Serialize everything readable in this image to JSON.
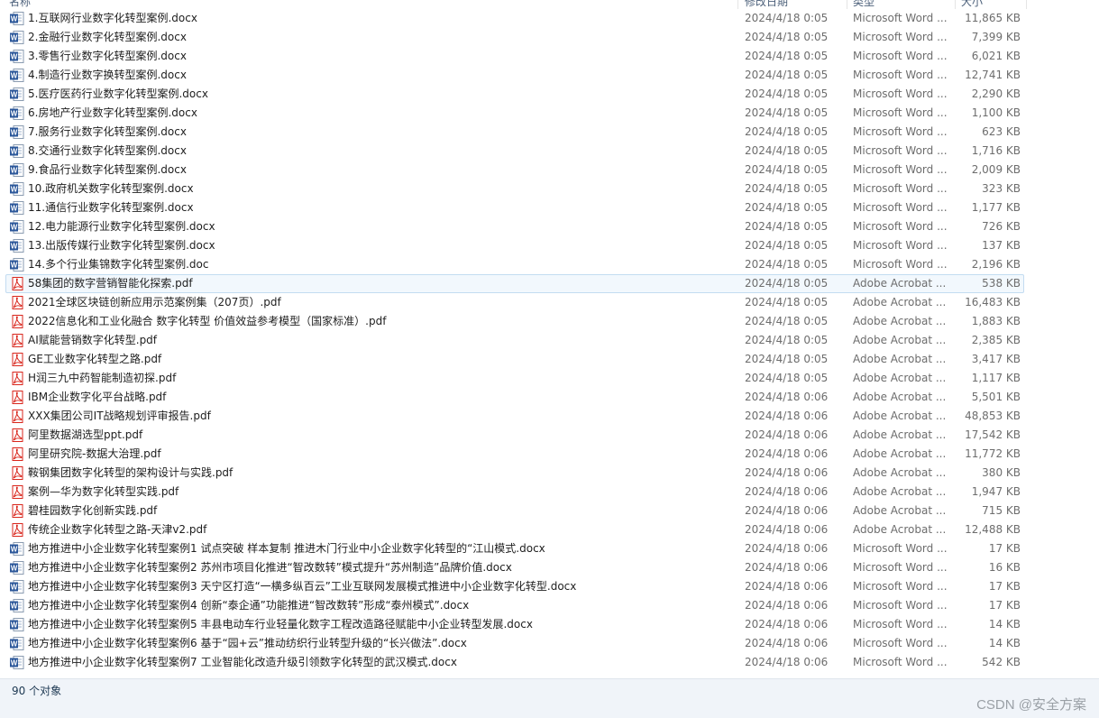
{
  "header": {
    "name": "名称",
    "date": "修改日期",
    "type": "类型",
    "size": "大小"
  },
  "rows": [
    {
      "name": "1.互联网行业数字化转型案例.docx",
      "date": "2024/4/18 0:05",
      "type": "Microsoft Word ...",
      "size": "11,865 KB",
      "icon": "word-icon"
    },
    {
      "name": "2.金融行业数字化转型案例.docx",
      "date": "2024/4/18 0:05",
      "type": "Microsoft Word ...",
      "size": "7,399 KB",
      "icon": "word-icon"
    },
    {
      "name": "3.零售行业数字化转型案例.docx",
      "date": "2024/4/18 0:05",
      "type": "Microsoft Word ...",
      "size": "6,021 KB",
      "icon": "word-icon"
    },
    {
      "name": "4.制造行业数字换转型案例.docx",
      "date": "2024/4/18 0:05",
      "type": "Microsoft Word ...",
      "size": "12,741 KB",
      "icon": "word-icon"
    },
    {
      "name": "5.医疗医药行业数字化转型案例.docx",
      "date": "2024/4/18 0:05",
      "type": "Microsoft Word ...",
      "size": "2,290 KB",
      "icon": "word-icon"
    },
    {
      "name": "6.房地产行业数字化转型案例.docx",
      "date": "2024/4/18 0:05",
      "type": "Microsoft Word ...",
      "size": "1,100 KB",
      "icon": "word-icon"
    },
    {
      "name": "7.服务行业数字化转型案例.docx",
      "date": "2024/4/18 0:05",
      "type": "Microsoft Word ...",
      "size": "623 KB",
      "icon": "word-icon"
    },
    {
      "name": "8.交通行业数字化转型案例.docx",
      "date": "2024/4/18 0:05",
      "type": "Microsoft Word ...",
      "size": "1,716 KB",
      "icon": "word-icon"
    },
    {
      "name": "9.食品行业数字化转型案例.docx",
      "date": "2024/4/18 0:05",
      "type": "Microsoft Word ...",
      "size": "2,009 KB",
      "icon": "word-icon"
    },
    {
      "name": "10.政府机关数字化转型案例.docx",
      "date": "2024/4/18 0:05",
      "type": "Microsoft Word ...",
      "size": "323 KB",
      "icon": "word-icon"
    },
    {
      "name": "11.通信行业数字化转型案例.docx",
      "date": "2024/4/18 0:05",
      "type": "Microsoft Word ...",
      "size": "1,177 KB",
      "icon": "word-icon"
    },
    {
      "name": "12.电力能源行业数字化转型案例.docx",
      "date": "2024/4/18 0:05",
      "type": "Microsoft Word ...",
      "size": "726 KB",
      "icon": "word-icon"
    },
    {
      "name": "13.出版传媒行业数字化转型案例.docx",
      "date": "2024/4/18 0:05",
      "type": "Microsoft Word ...",
      "size": "137 KB",
      "icon": "word-icon"
    },
    {
      "name": "14.多个行业集锦数字化转型案例.doc",
      "date": "2024/4/18 0:05",
      "type": "Microsoft Word ...",
      "size": "2,196 KB",
      "icon": "word-icon"
    },
    {
      "name": "58集团的数字营销智能化探索.pdf",
      "date": "2024/4/18 0:05",
      "type": "Adobe Acrobat ...",
      "size": "538 KB",
      "icon": "pdf-icon",
      "selected": true
    },
    {
      "name": "2021全球区块链创新应用示范案例集（207页）.pdf",
      "date": "2024/4/18 0:05",
      "type": "Adobe Acrobat ...",
      "size": "16,483 KB",
      "icon": "pdf-icon"
    },
    {
      "name": "2022信息化和工业化融合 数字化转型 价值效益参考模型（国家标准）.pdf",
      "date": "2024/4/18 0:05",
      "type": "Adobe Acrobat ...",
      "size": "1,883 KB",
      "icon": "pdf-icon"
    },
    {
      "name": "AI赋能营销数字化转型.pdf",
      "date": "2024/4/18 0:05",
      "type": "Adobe Acrobat ...",
      "size": "2,385 KB",
      "icon": "pdf-icon"
    },
    {
      "name": "GE工业数字化转型之路.pdf",
      "date": "2024/4/18 0:05",
      "type": "Adobe Acrobat ...",
      "size": "3,417 KB",
      "icon": "pdf-icon"
    },
    {
      "name": "H润三九中药智能制造初探.pdf",
      "date": "2024/4/18 0:05",
      "type": "Adobe Acrobat ...",
      "size": "1,117 KB",
      "icon": "pdf-icon"
    },
    {
      "name": "IBM企业数字化平台战略.pdf",
      "date": "2024/4/18 0:06",
      "type": "Adobe Acrobat ...",
      "size": "5,501 KB",
      "icon": "pdf-icon"
    },
    {
      "name": "XXX集团公司IT战略规划评审报告.pdf",
      "date": "2024/4/18 0:06",
      "type": "Adobe Acrobat ...",
      "size": "48,853 KB",
      "icon": "pdf-icon"
    },
    {
      "name": "阿里数据湖选型ppt.pdf",
      "date": "2024/4/18 0:06",
      "type": "Adobe Acrobat ...",
      "size": "17,542 KB",
      "icon": "pdf-icon"
    },
    {
      "name": "阿里研究院-数据大治理.pdf",
      "date": "2024/4/18 0:06",
      "type": "Adobe Acrobat ...",
      "size": "11,772 KB",
      "icon": "pdf-icon"
    },
    {
      "name": "鞍钢集团数字化转型的架构设计与实践.pdf",
      "date": "2024/4/18 0:06",
      "type": "Adobe Acrobat ...",
      "size": "380 KB",
      "icon": "pdf-icon"
    },
    {
      "name": "案例—华为数字化转型实践.pdf",
      "date": "2024/4/18 0:06",
      "type": "Adobe Acrobat ...",
      "size": "1,947 KB",
      "icon": "pdf-icon"
    },
    {
      "name": "碧桂园数字化创新实践.pdf",
      "date": "2024/4/18 0:06",
      "type": "Adobe Acrobat ...",
      "size": "715 KB",
      "icon": "pdf-icon"
    },
    {
      "name": "传统企业数字化转型之路-天津v2.pdf",
      "date": "2024/4/18 0:06",
      "type": "Adobe Acrobat ...",
      "size": "12,488 KB",
      "icon": "pdf-icon"
    },
    {
      "name": "地方推进中小企业数字化转型案例1 试点突破 样本复制 推进木门行业中小企业数字化转型的“江山模式.docx",
      "date": "2024/4/18 0:06",
      "type": "Microsoft Word ...",
      "size": "17 KB",
      "icon": "word-icon"
    },
    {
      "name": "地方推进中小企业数字化转型案例2 苏州市项目化推进“智改数转”模式提升“苏州制造”品牌价值.docx",
      "date": "2024/4/18 0:06",
      "type": "Microsoft Word ...",
      "size": "16 KB",
      "icon": "word-icon"
    },
    {
      "name": "地方推进中小企业数字化转型案例3 天宁区打造“一横多纵百云”工业互联网发展模式推进中小企业数字化转型.docx",
      "date": "2024/4/18 0:06",
      "type": "Microsoft Word ...",
      "size": "17 KB",
      "icon": "word-icon"
    },
    {
      "name": "地方推进中小企业数字化转型案例4 创新“泰企通”功能推进“智改数转”形成“泰州模式”.docx",
      "date": "2024/4/18 0:06",
      "type": "Microsoft Word ...",
      "size": "17 KB",
      "icon": "word-icon"
    },
    {
      "name": "地方推进中小企业数字化转型案例5 丰县电动车行业轻量化数字工程改造路径赋能中小企业转型发展.docx",
      "date": "2024/4/18 0:06",
      "type": "Microsoft Word ...",
      "size": "14 KB",
      "icon": "word-icon"
    },
    {
      "name": "地方推进中小企业数字化转型案例6 基于“园+云”推动纺织行业转型升级的“长兴做法”.docx",
      "date": "2024/4/18 0:06",
      "type": "Microsoft Word ...",
      "size": "14 KB",
      "icon": "word-icon"
    },
    {
      "name": "地方推进中小企业数字化转型案例7 工业智能化改造升级引领数字化转型的武汉模式.docx",
      "date": "2024/4/18 0:06",
      "type": "Microsoft Word ...",
      "size": "542 KB",
      "icon": "word-icon"
    }
  ],
  "statusbar": {
    "count": "90 个对象"
  },
  "watermark": "CSDN @安全方案",
  "colors": {
    "word": "#2b579a",
    "pdf": "#d9261c",
    "selection_border": "#c3dcf1",
    "selection_fill": "#f2f8fd"
  }
}
